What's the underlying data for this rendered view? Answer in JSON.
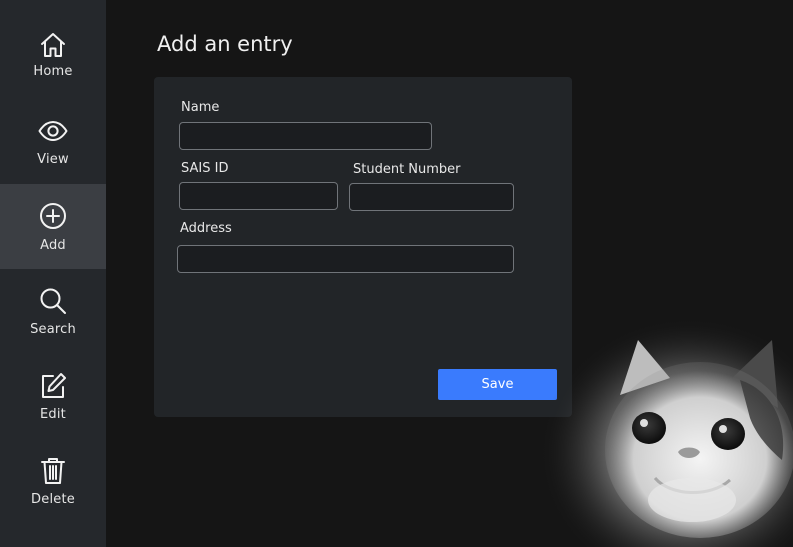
{
  "sidebar": {
    "items": [
      {
        "label": "Home",
        "icon": "home-icon",
        "active": false
      },
      {
        "label": "View",
        "icon": "eye-icon",
        "active": false
      },
      {
        "label": "Add",
        "icon": "plus-circle-icon",
        "active": true
      },
      {
        "label": "Search",
        "icon": "search-icon",
        "active": false
      },
      {
        "label": "Edit",
        "icon": "edit-icon",
        "active": false
      },
      {
        "label": "Delete",
        "icon": "trash-icon",
        "active": false
      }
    ]
  },
  "main": {
    "title": "Add an entry",
    "form": {
      "name_label": "Name",
      "name_value": "",
      "sais_label": "SAIS ID",
      "sais_value": "",
      "student_number_label": "Student Number",
      "student_number_value": "",
      "address_label": "Address",
      "address_value": "",
      "save_label": "Save"
    }
  },
  "colors": {
    "background": "#151515",
    "sidebar": "#25282c",
    "sidebar_active": "#3b3e43",
    "card": "#222528",
    "accent": "#3a7bfd"
  }
}
